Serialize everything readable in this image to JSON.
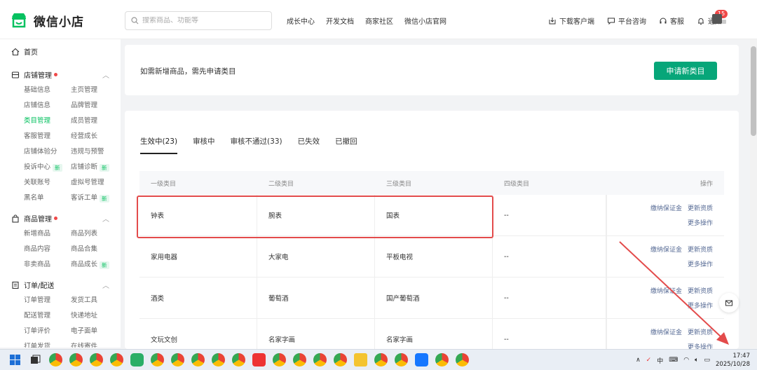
{
  "app": {
    "name": "微信小店"
  },
  "search": {
    "placeholder": "搜索商品、功能等"
  },
  "nav": [
    "成长中心",
    "开发文档",
    "商家社区",
    "微信小店官网"
  ],
  "tools": {
    "download": "下载客户端",
    "consult": "平台咨询",
    "service": "客服",
    "notify": "通知",
    "notify_count": "15"
  },
  "sidebar": {
    "home": "首页",
    "groups": [
      {
        "title": "店铺管理",
        "items": [
          "基础信息",
          "主页管理",
          "店铺信息",
          "品牌管理",
          "类目管理",
          "成员管理",
          "客服管理",
          "经营成长",
          "店铺体验分",
          "违规与预警",
          "投诉中心",
          "店铺诊断",
          "关联账号",
          "虚拟号管理",
          "黑名单",
          "客诉工单"
        ],
        "new_badge": "新"
      },
      {
        "title": "商品管理",
        "items": [
          "新增商品",
          "商品列表",
          "商品内容",
          "商品合集",
          "非卖商品",
          "商品成长"
        ]
      },
      {
        "title": "订单/配送",
        "items": [
          "订单管理",
          "发货工具",
          "配送管理",
          "快递地址",
          "订单评价",
          "电子面单",
          "打单发货",
          "在线寄件"
        ]
      }
    ]
  },
  "notice": {
    "text": "如需新增商品，需先申请类目",
    "button": "申请新类目"
  },
  "tabs": [
    "生效中(23)",
    "审核中",
    "审核不通过(33)",
    "已失效",
    "已撤回"
  ],
  "table": {
    "headers": [
      "一级类目",
      "二级类目",
      "三级类目",
      "四级类目",
      "操作"
    ],
    "rows": [
      [
        "钟表",
        "腕表",
        "国表",
        "--"
      ],
      [
        "家用电器",
        "大家电",
        "平板电视",
        "--"
      ],
      [
        "酒类",
        "葡萄酒",
        "国产葡萄酒",
        "--"
      ],
      [
        "文玩文创",
        "名家字画",
        "名家字画",
        "--"
      ]
    ],
    "ops": {
      "deposit": "缴纳保证金",
      "update": "更新资质",
      "more": "更多操作"
    }
  },
  "taskbar": {
    "ime": "中",
    "time": "17:47",
    "date": "2025/10/28"
  },
  "colors": {
    "accent": "#07a679",
    "highlight": "#e34b4b",
    "link": "#576b95"
  }
}
